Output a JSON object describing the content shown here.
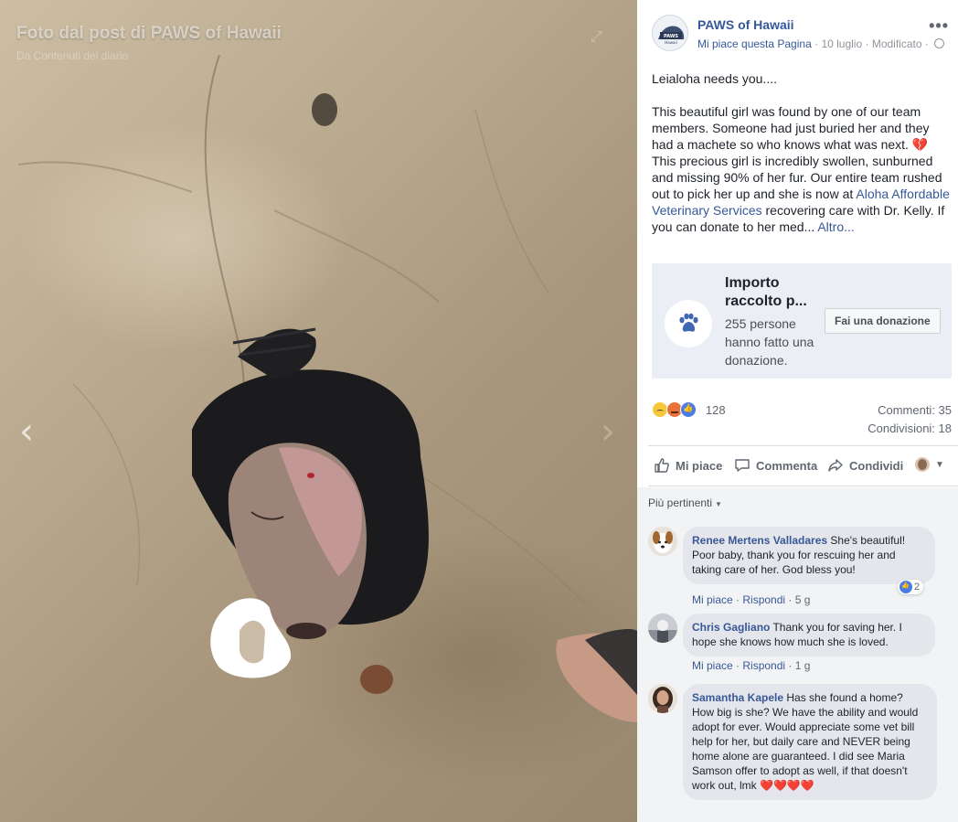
{
  "photo": {
    "caption": "Foto dal post di PAWS of Hawaii",
    "subcaption": "Da Contenuti del diario",
    "prev_icon": "chevron-left-icon",
    "next_icon": "chevron-right-icon"
  },
  "post": {
    "page_name": "PAWS of Hawaii",
    "like_page": "Mi piace questa Pagina",
    "date": "10 luglio",
    "edited": "Modificato",
    "more_icon": "more-options-icon",
    "text_p1": "Leialoha needs you....",
    "text_p2a": "This beautiful girl was found by one of our team members. Someone had just buried her and they had a machete so who knows what was next. ",
    "broken_heart": "💔",
    "text_p2b": " This precious girl is incredibly swollen, sunburned and missing 90% of her fur. Our entire team rushed out to pick her up and she is now at ",
    "link_vet": "Aloha Affordable Veterinary Services",
    "text_p2c": " recovering care with Dr. Kelly. If you can donate to her med... ",
    "more_link": "Altro..."
  },
  "fundraiser": {
    "title": "Importo raccolto p...",
    "description": "255 persone hanno fatto una donazione.",
    "button": "Fai una donazione",
    "icon": "paw-icon"
  },
  "engagement": {
    "reaction_count": "128",
    "comments": "Commenti: 35",
    "shares": "Condivisioni: 18"
  },
  "actions": {
    "like": "Mi piace",
    "comment": "Commenta",
    "share": "Condividi"
  },
  "comments_filter": "Più pertinenti",
  "comments": [
    {
      "author": "Renee Mertens Valladares",
      "text": " She's beautiful! Poor baby, thank you for rescuing her and taking care of her. God bless you!",
      "like": "Mi piace",
      "reply": "Rispondi",
      "time": "5 g",
      "reactions": "2"
    },
    {
      "author": "Chris Gagliano",
      "text": " Thank you for saving her. I hope she knows how much she is loved.",
      "like": "Mi piace",
      "reply": "Rispondi",
      "time": "1 g"
    },
    {
      "author": "Samantha Kapele",
      "text": " Has she found a home? How big is she? We have the ability and would adopt for ever. Would appreciate some vet bill help for her, but daily care and NEVER being home alone are guaranteed. I did see Maria Samson offer to adopt as well, if that doesn't work out, lmk ",
      "hearts": "❤️❤️❤️❤️"
    }
  ],
  "colors": {
    "link": "#365899",
    "comment_bg": "#f2f3f5",
    "fund_bg": "#eceef5",
    "like_blue": "#4a7ce6"
  }
}
